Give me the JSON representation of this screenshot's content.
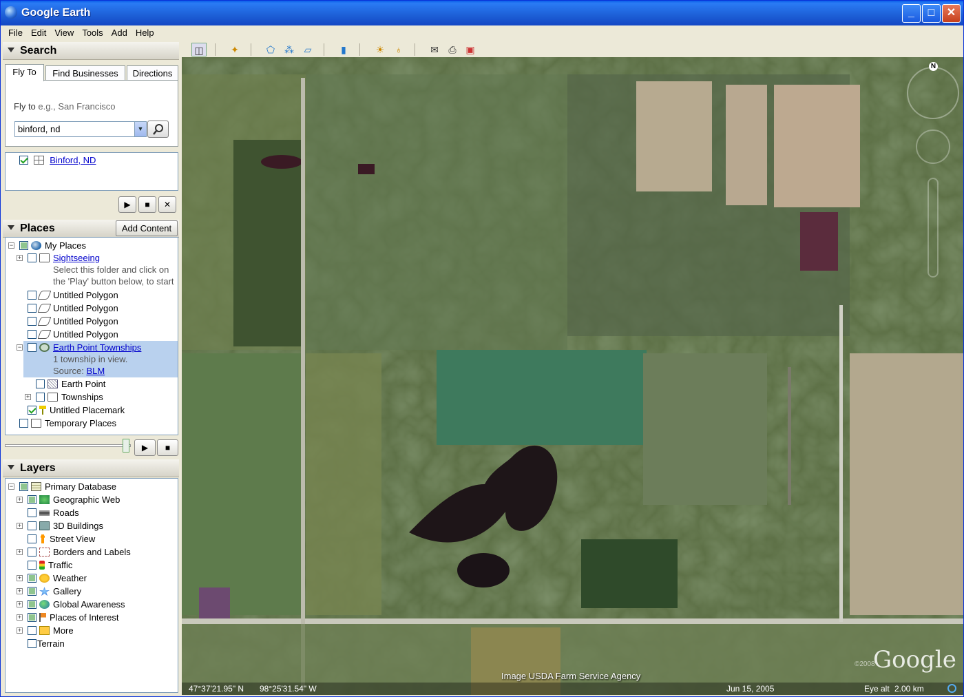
{
  "window": {
    "title": "Google Earth",
    "min": "_",
    "max": "□",
    "close": "✕"
  },
  "menu": [
    "File",
    "Edit",
    "View",
    "Tools",
    "Add",
    "Help"
  ],
  "search": {
    "heading": "Search",
    "tabs": [
      "Fly To",
      "Find Businesses",
      "Directions"
    ],
    "fly_label": "Fly to",
    "fly_hint": "e.g., San Francisco",
    "input_value": "binford, nd",
    "result": "Binford, ND"
  },
  "places": {
    "heading": "Places",
    "add_content": "Add Content",
    "items": [
      {
        "label": "My Places"
      },
      {
        "label": "Sightseeing",
        "note1": "Select this folder and click on",
        "note2": "the 'Play' button below, to start"
      },
      {
        "label": "Untitled Polygon"
      },
      {
        "label": "Untitled Polygon"
      },
      {
        "label": "Untitled Polygon"
      },
      {
        "label": "Untitled Polygon"
      },
      {
        "label": "Earth Point Townships",
        "note1": "1 township in view.",
        "note2": "Source:",
        "link": "BLM"
      },
      {
        "label": "Earth Point"
      },
      {
        "label": "Townships"
      },
      {
        "label": "Untitled Placemark"
      },
      {
        "label": "Temporary Places"
      }
    ]
  },
  "layers": {
    "heading": "Layers",
    "items": [
      "Primary Database",
      "Geographic Web",
      "Roads",
      "3D Buildings",
      "Street View",
      "Borders and Labels",
      "Traffic",
      "Weather",
      "Gallery",
      "Global Awareness",
      "Places of Interest",
      "More",
      "Terrain"
    ]
  },
  "map": {
    "attribution": "Image USDA Farm Service Agency",
    "lat": "47°37'21.95\" N",
    "lon": "98°25'31.54\" W",
    "date": "Jun 15, 2005",
    "eye_alt_label": "Eye alt",
    "eye_alt_value": "2.00 km",
    "logo": "Google",
    "logo_year": "©2008",
    "north": "N"
  },
  "colors": {
    "accent": "#0a5ee8",
    "selection": "#b9d1ee",
    "link": "#0000cc"
  }
}
